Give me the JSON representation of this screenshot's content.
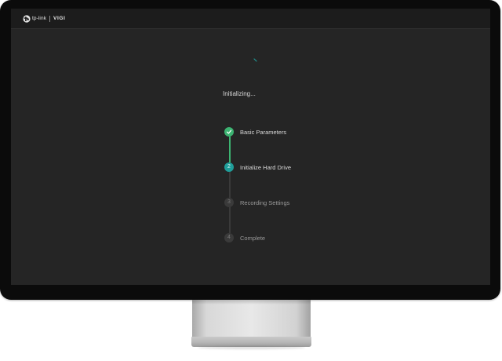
{
  "header": {
    "brand": "tp-link",
    "product": "VIGI",
    "logo_icon": "tp-link-logo-icon"
  },
  "main": {
    "spinner_icon": "loading-spinner-icon",
    "status_text": "Initializing..."
  },
  "stepper": {
    "steps": [
      {
        "number": "",
        "label": "Basic Parameters",
        "state": "done",
        "icon": "checkmark-icon"
      },
      {
        "number": "2",
        "label": "Initialize Hard Drive",
        "state": "active"
      },
      {
        "number": "3",
        "label": "Recording Settings",
        "state": "pending"
      },
      {
        "number": "4",
        "label": "Complete",
        "state": "pending"
      }
    ]
  },
  "colors": {
    "screen_bg": "#252525",
    "done": "#3cb371",
    "active": "#1f9e9a",
    "pending": "#3a3a3a"
  }
}
